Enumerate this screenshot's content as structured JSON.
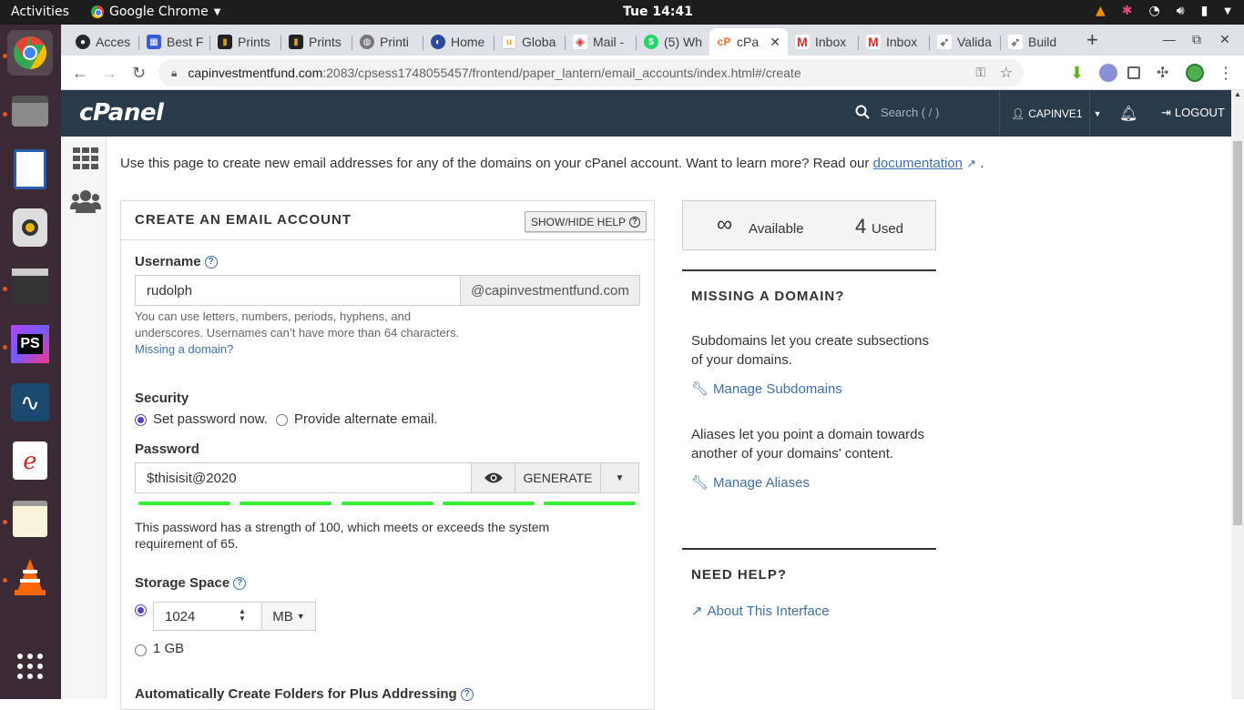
{
  "os": {
    "activities": "Activities",
    "app_name": "Google Chrome",
    "clock": "Tue 14:41"
  },
  "tabs": [
    {
      "label": "Acces",
      "icon": "github-icon",
      "color": "#24292e"
    },
    {
      "label": "Best F",
      "icon": "app-icon",
      "color": "#3b5bdb"
    },
    {
      "label": "Prints",
      "icon": "printshop-icon",
      "color": "#222"
    },
    {
      "label": "Prints",
      "icon": "printshop-icon",
      "color": "#222"
    },
    {
      "label": "Printi",
      "icon": "globe-icon",
      "color": "#777"
    },
    {
      "label": "Home",
      "icon": "planet-icon",
      "color": "#2b4c9e"
    },
    {
      "label": "Globa",
      "icon": "u-icon",
      "color": "#f59f00"
    },
    {
      "label": "Mail -",
      "icon": "laravel-icon",
      "color": "#e03131"
    },
    {
      "label": "(5) Wh",
      "icon": "whatsapp-icon",
      "color": "#25d366"
    },
    {
      "label": "cPa",
      "icon": "cpanel-icon",
      "color": "#ff6c2c",
      "active": true
    },
    {
      "label": "Inbox",
      "icon": "gmail-icon",
      "color": "#d93025"
    },
    {
      "label": "Inbox",
      "icon": "gmail-icon",
      "color": "#d93025"
    },
    {
      "label": "Valida",
      "icon": "paper-plane-icon",
      "color": "#3c4043"
    },
    {
      "label": "Build",
      "icon": "paper-plane-icon",
      "color": "#3c4043"
    }
  ],
  "address": {
    "host": "capinvestmentfund.com",
    "path": ":2083/cpsess1748055457/frontend/paper_lantern/email_accounts/index.html#/create"
  },
  "cpanel": {
    "logo": "cPanel",
    "search_placeholder": "Search ( / )",
    "user": "CAPINVE1",
    "logout": "LOGOUT"
  },
  "intro": {
    "text": "Use this page to create new email addresses for any of the domains on your cPanel account. Want to learn more? Read our ",
    "link": "documentation",
    "end": "."
  },
  "form": {
    "title": "CREATE AN EMAIL ACCOUNT",
    "show_hide": "SHOW/HIDE HELP",
    "username_label": "Username",
    "username_value": "rudolph",
    "domain_suffix": "@capinvestmentfund.com",
    "username_help": "You can use letters, numbers, periods, hyphens, and underscores. Usernames can’t have more than 64 characters.",
    "missing_domain_link": "Missing a domain?",
    "security_label": "Security",
    "security_option_1": "Set password now.",
    "security_option_2": "Provide alternate email.",
    "password_label": "Password",
    "password_value": "$thisisit@2020",
    "generate": "GENERATE",
    "strength_text": "This password has a strength of 100, which meets or exceeds the system requirement of 65.",
    "strength_percent": 100,
    "storage_label": "Storage Space",
    "storage_value": "1024",
    "storage_unit": "MB",
    "storage_option_2": "1 GB",
    "plus_addressing_label": "Automatically Create Folders for Plus Addressing"
  },
  "side": {
    "available_symbol": "∞",
    "available_label": "Available",
    "used_count": "4",
    "used_label": "Used",
    "missing_title": "MISSING A DOMAIN?",
    "subdomains_text": "Subdomains let you create subsections of your domains.",
    "manage_subdomains": "Manage Subdomains",
    "aliases_text": "Aliases let you point a domain towards another of your domains’ content.",
    "manage_aliases": "Manage Aliases",
    "help_title": "NEED HELP?",
    "about_link": "About This Interface"
  }
}
